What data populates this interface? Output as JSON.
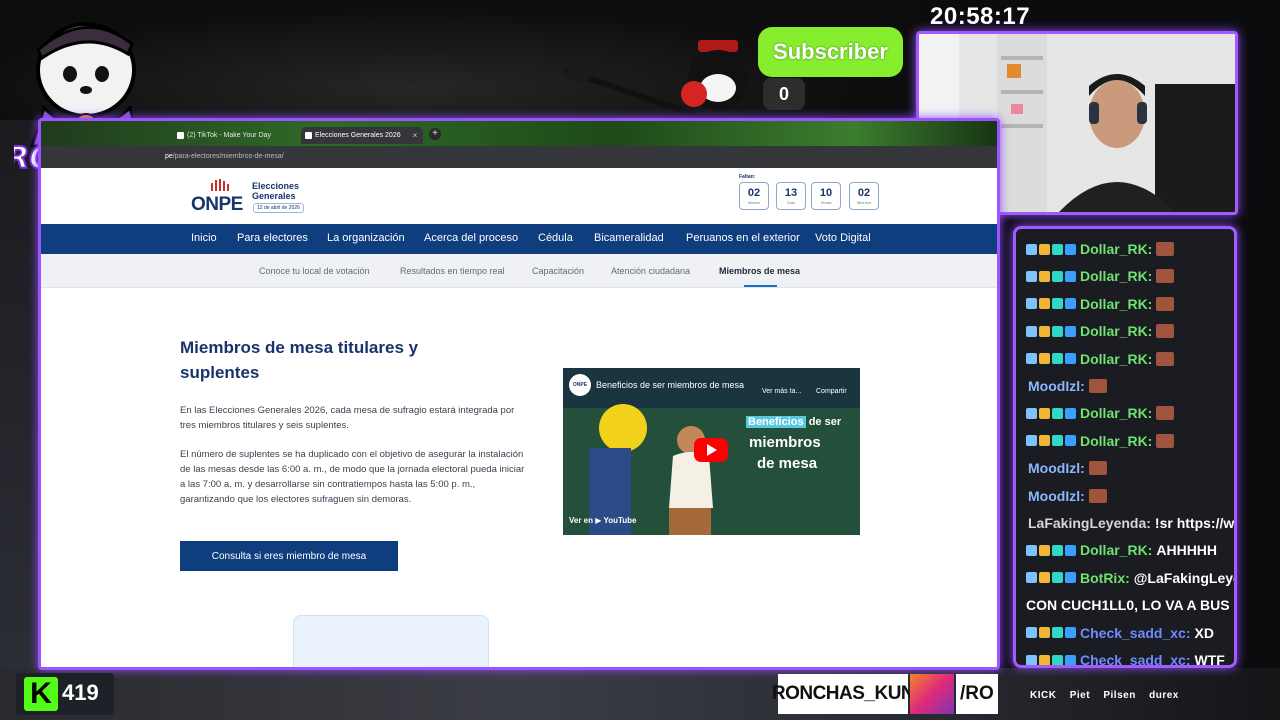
{
  "overlay": {
    "clock": "20:58:17",
    "subscriber_label": "Subscriber",
    "subscriber_count": "0",
    "streamer_logo": "RONCHAS",
    "kick_count": "419",
    "social_handle": "RONCHAS_KUN",
    "social_slash": "/RO",
    "sponsors": [
      "KICK",
      "Piet",
      "Pilsen",
      "durex"
    ]
  },
  "browser": {
    "tabs": [
      {
        "label": "(2) TikTok - Make Your Day"
      },
      {
        "label": "Elecciones Generales 2026"
      }
    ],
    "new_tab": "+",
    "url_prefix": "pe",
    "url_path": "/para-electores/miembros-de-mesa/"
  },
  "onpe": {
    "logo": "ONPE",
    "elecciones_title": "Elecciones Generales",
    "elecciones_date": "12 de abril de 2026",
    "countdown_label": "Faltan:",
    "countdown": [
      {
        "value": "02",
        "unit": "Meses"
      },
      {
        "value": "13",
        "unit": "Días"
      },
      {
        "value": "10",
        "unit": "Horas"
      },
      {
        "value": "02",
        "unit": "Minutos"
      }
    ],
    "nav": [
      "Inicio",
      "Para electores",
      "La organización",
      "Acerca del proceso",
      "Cédula",
      "Bicameralidad",
      "Peruanos en el exterior",
      "Voto Digital"
    ],
    "subnav": [
      "Conoce tu local de votación",
      "Resultados en tiempo real",
      "Capacitación",
      "Atención ciudadana",
      "Miembros de mesa"
    ],
    "title": "Miembros de mesa titulares y suplentes",
    "para1": "En las Elecciones Generales 2026, cada mesa de sufragio estará integrada por tres miembros titulares y seis suplentes.",
    "para2": "El número de suplentes se ha duplicado con el objetivo de asegurar la instalación de las mesas desde las 6:00 a. m., de modo que la jornada electoral pueda iniciar a las 7:00 a. m. y desarrollarse sin contratiempos hasta las 5:00 p. m., garantizando que los electores sufraguen sin demoras.",
    "cta": "Consulta si eres miembro de mesa",
    "video": {
      "title": "Beneficios de ser miembros de mesa",
      "channel": "ONPE",
      "watch_later": "Ver más ta...",
      "share": "Compartir",
      "overlay_word": "Beneficios",
      "overlay_rest": "de ser",
      "line2": "miembros",
      "line3": "de mesa",
      "watch_on": "Ver en ▶ YouTube"
    }
  },
  "chat": [
    {
      "user": "Dollar_RK:",
      "msg": "",
      "color": "#6fe26f",
      "badges": true,
      "emote": true
    },
    {
      "user": "Dollar_RK:",
      "msg": "",
      "color": "#6fe26f",
      "badges": true,
      "emote": true
    },
    {
      "user": "Dollar_RK:",
      "msg": "",
      "color": "#6fe26f",
      "badges": true,
      "emote": true
    },
    {
      "user": "Dollar_RK:",
      "msg": "",
      "color": "#6fe26f",
      "badges": true,
      "emote": true
    },
    {
      "user": "Dollar_RK:",
      "msg": "",
      "color": "#6fe26f",
      "badges": true,
      "emote": true
    },
    {
      "user": "MoodIzl:",
      "msg": "",
      "color": "#8ab8ff",
      "badges": false,
      "emote": true
    },
    {
      "user": "Dollar_RK:",
      "msg": "",
      "color": "#6fe26f",
      "badges": true,
      "emote": true
    },
    {
      "user": "Dollar_RK:",
      "msg": "",
      "color": "#6fe26f",
      "badges": true,
      "emote": true
    },
    {
      "user": "MoodIzl:",
      "msg": "",
      "color": "#8ab8ff",
      "badges": false,
      "emote": true
    },
    {
      "user": "MoodIzl:",
      "msg": "",
      "color": "#8ab8ff",
      "badges": false,
      "emote": true
    },
    {
      "user": "LaFakingLeyenda:",
      "msg": "!sr https://w",
      "color": "#d7d7d7",
      "badges": false,
      "emote": false
    },
    {
      "user": "Dollar_RK:",
      "msg": "AHHHHH",
      "color": "#6fe26f",
      "badges": true,
      "emote": false
    },
    {
      "user": "BotRix:",
      "msg": "@LaFakingLeyen",
      "color": "#6fe26f",
      "badges": true,
      "emote": false
    },
    {
      "user": "",
      "msg": "CON CUCH1LL0, LO VA A BUS",
      "color": "#fff",
      "badges": false,
      "emote": false
    },
    {
      "user": "Check_sadd_xc:",
      "msg": "XD",
      "color": "#6e8cff",
      "badges": true,
      "emote": false
    },
    {
      "user": "Check_sadd_xc:",
      "msg": "WTF",
      "color": "#6e8cff",
      "badges": true,
      "emote": false
    }
  ],
  "colors": {
    "accent": "#a05cff",
    "onpe_blue": "#0f3e7e",
    "kick_green": "#53fc18",
    "subscriber_green": "#86ee2f"
  }
}
